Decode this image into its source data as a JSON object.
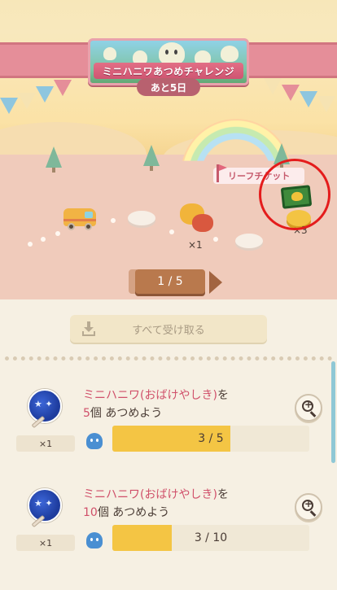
{
  "event": {
    "title": "ミニハニワあつめチャレンジ",
    "days_left": "あと5日"
  },
  "map": {
    "reward_count": "×1",
    "leaf_ticket_label": "リーフチケット",
    "leaf_ticket_count": "×3"
  },
  "pager": {
    "label": "1 / 5"
  },
  "panel": {
    "claim_all_label": "すべて受け取る"
  },
  "missions": [
    {
      "title_highlight": "ミニハニワ(おばけやしき)",
      "title_suffix": "を",
      "goal_number": "5",
      "goal_text": "個 あつめよう",
      "reward_qty": "×1",
      "progress_text": "3 / 5",
      "progress": 0.6
    },
    {
      "title_highlight": "ミニハニワ(おばけやしき)",
      "title_suffix": "を",
      "goal_number": "10",
      "goal_text": "個 あつめよう",
      "reward_qty": "×1",
      "progress_text": "3 / 10",
      "progress": 0.3
    }
  ],
  "colors": {
    "accent_red": "#d0506a",
    "progress_yellow": "#f4c544",
    "banner_pink": "#e58e99"
  }
}
